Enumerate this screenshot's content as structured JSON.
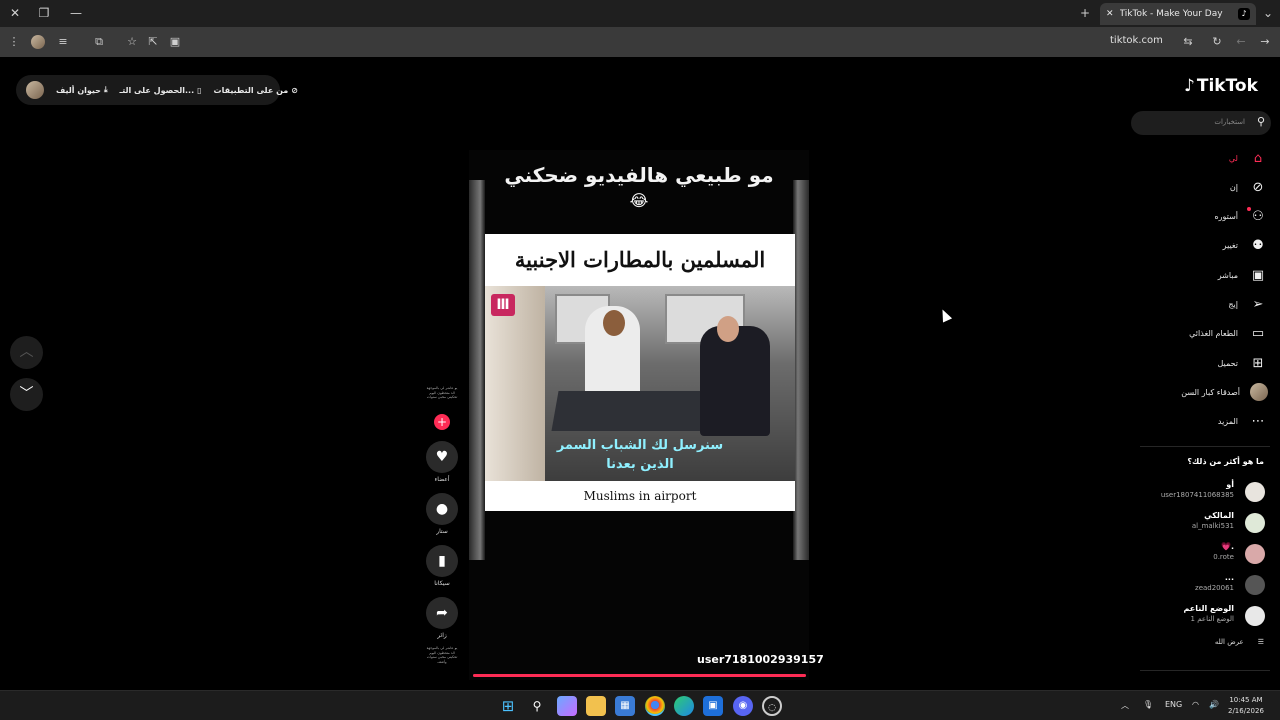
{
  "browser": {
    "tab_title": "TikTok - Make Your Day",
    "tab_logo": "♪",
    "url": "tiktok.com"
  },
  "top_pill": {
    "item1": "من على التطبيقات",
    "item2": "الحصول على التـ...",
    "item3": "حيوان أليف"
  },
  "video": {
    "caption_line1": "مو طبيعي هالفيديو ضحكني",
    "caption_emoji": "😂",
    "banner": "المسلمين بالمطارات الاجنبية",
    "subtitle_ar_line1": "سنرسل لك الشباب السمر",
    "subtitle_ar_line2": "الذين بعدنا",
    "subtitle_en": "Muslims in airport",
    "username": "user7181002939157",
    "progress": 1.0
  },
  "actions": {
    "tiny_top": "يو عاشر لي بالموجهة الذ متحطون اليوم تحكيني مخبي سنوات",
    "like_label": "أعضاء",
    "comment_label": "ستار",
    "save_label": "سيكانا",
    "share_label": "زائر",
    "tiny_bottom": "يو عاشر لي بالموجهة الذ متحطون اليوم تحكيني مخبي سنوات وأضف"
  },
  "sidebar": {
    "logo_text": "TikTok",
    "search_placeholder": "استخبارات",
    "nav": [
      {
        "label": "لي",
        "icon": "home-icon",
        "active": true
      },
      {
        "label": "إن",
        "icon": "compass-icon",
        "active": false
      },
      {
        "label": "أستوره",
        "icon": "following-icon",
        "active": false
      },
      {
        "label": "تغيير",
        "icon": "friends-icon",
        "active": false
      },
      {
        "label": "مباشر",
        "icon": "live-icon",
        "active": false
      },
      {
        "label": "إيج",
        "icon": "send-icon",
        "active": false
      },
      {
        "label": "الطعام الغذائي",
        "icon": "message-icon",
        "active": false
      },
      {
        "label": "تحميل",
        "icon": "upload-icon",
        "active": false
      },
      {
        "label": "أصدقاء كبار السن",
        "icon": "profile-avatar",
        "active": false
      },
      {
        "label": "المزيد",
        "icon": "more-icon",
        "active": false
      }
    ],
    "section_title": "ما هو أكثر من ذلك؟",
    "following": [
      {
        "name": "أو",
        "handle": "user1807411068385"
      },
      {
        "name": "المالكي",
        "handle": "al_malki531"
      },
      {
        "name": "💗.",
        "handle": "0.rote"
      },
      {
        "name": "...",
        "handle": "zead20061"
      },
      {
        "name": "الوضع الناعم",
        "handle": "الوضع الناعم 1"
      }
    ],
    "see_all": "عرض الله"
  },
  "taskbar": {
    "lang": "ENG",
    "time": "10:45 AM",
    "date": "2/16/2026"
  }
}
